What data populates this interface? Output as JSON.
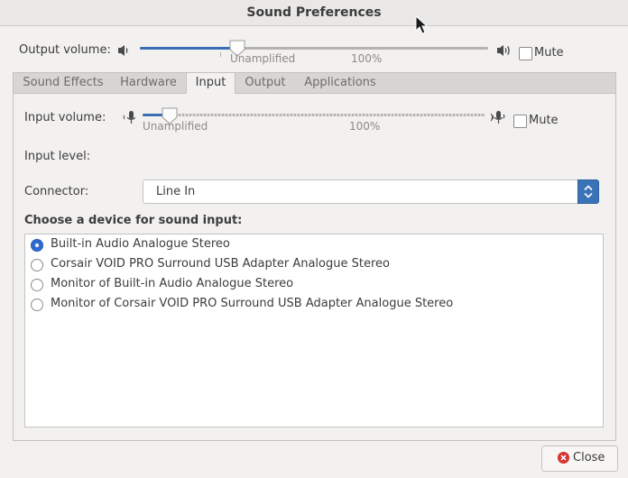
{
  "window": {
    "title": "Sound Preferences"
  },
  "output_volume": {
    "label": "Output volume:",
    "level": 0.28,
    "tick_unamplified": "Unamplified",
    "tick_100": "100%",
    "mute_label": "Mute",
    "muted": false
  },
  "tabs": [
    {
      "label": "Sound Effects",
      "active": false
    },
    {
      "label": "Hardware",
      "active": false
    },
    {
      "label": "Input",
      "active": true
    },
    {
      "label": "Output",
      "active": false
    },
    {
      "label": "Applications",
      "active": false
    }
  ],
  "input_volume": {
    "label": "Input volume:",
    "level": 0.08,
    "tick_unamplified": "Unamplified",
    "tick_100": "100%",
    "mute_label": "Mute",
    "muted": false
  },
  "input_level": {
    "label": "Input level:"
  },
  "connector": {
    "label": "Connector:",
    "value": "Line In"
  },
  "device_section": {
    "heading": "Choose a device for sound input:"
  },
  "devices": [
    {
      "name": "Built-in Audio Analogue Stereo",
      "selected": true
    },
    {
      "name": "Corsair VOID PRO Surround USB Adapter Analogue Stereo",
      "selected": false
    },
    {
      "name": "Monitor of Built-in Audio Analogue Stereo",
      "selected": false
    },
    {
      "name": "Monitor of Corsair VOID PRO Surround USB Adapter Analogue Stereo",
      "selected": false
    }
  ],
  "footer": {
    "close_label": "Close"
  },
  "colors": {
    "accent": "#3b73b9",
    "close_icon": "#d8352f",
    "slider_fill": "#3b6db3"
  }
}
